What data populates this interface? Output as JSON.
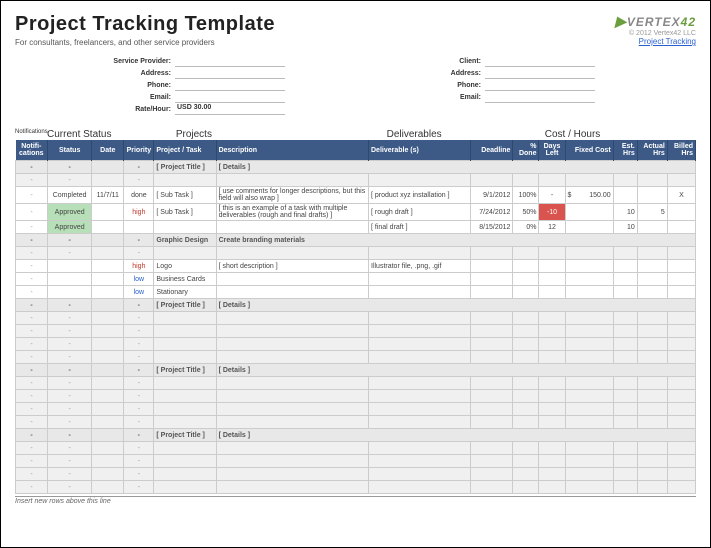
{
  "header": {
    "title": "Project Tracking Template",
    "subtitle": "For consultants, freelancers, and other service providers",
    "logo_text": "VERTEX",
    "logo_suffix": "42",
    "copyright": "© 2012 Vertex42 LLC",
    "link": "Project Tracking"
  },
  "provider": {
    "labels": {
      "name": "Service Provider:",
      "address": "Address:",
      "phone": "Phone:",
      "email": "Email:",
      "rate": "Rate/Hour:"
    },
    "rate": "USD 30.00"
  },
  "client": {
    "labels": {
      "name": "Client:",
      "address": "Address:",
      "phone": "Phone:",
      "email": "Email:"
    }
  },
  "groups": {
    "notif": "Notifications",
    "status": "Current Status",
    "projects": "Projects",
    "deliv": "Deliverables",
    "cost": "Cost / Hours"
  },
  "cols": {
    "notif": "Notifi-cations",
    "status": "Status",
    "date": "Date",
    "prio": "Priority",
    "proj": "Project / Task",
    "desc": "Description",
    "deliv": "Deliverable (s)",
    "dead": "Deadline",
    "pct": "% Done",
    "days": "Days Left",
    "fixed": "Fixed Cost",
    "est": "Est. Hrs",
    "act": "Actual Hrs",
    "bill": "Billed Hrs"
  },
  "rows": [
    {
      "type": "section",
      "proj": "[ Project Title ]",
      "desc": "[ Details ]"
    },
    {
      "type": "blank"
    },
    {
      "type": "data",
      "status": "Completed",
      "date": "11/7/11",
      "prio": "done",
      "proj": "[ Sub Task ]",
      "desc": "[ use comments for longer descriptions, but this field will also wrap ]",
      "deliv": "[ product xyz installation ]",
      "dead": "9/1/2012",
      "pct": "100%",
      "days": "-",
      "fixedp": "$",
      "fixed": "150.00",
      "bill": "X"
    },
    {
      "type": "data",
      "approved": true,
      "prio": "high",
      "prioClass": "red",
      "proj": "[ Sub Task ]",
      "desc": "[ this is an example of a task with multiple deliverables (rough and final drafts) ]",
      "deliv": "[ rough draft ]",
      "dead": "7/24/2012",
      "pct": "50%",
      "days": "-10",
      "daysNeg": true,
      "est": "10",
      "act": "5"
    },
    {
      "type": "data",
      "approved": true,
      "deliv": "[ final draft ]",
      "dead": "8/15/2012",
      "pct": "0%",
      "days": "12",
      "est": "10"
    },
    {
      "type": "section",
      "proj": "Graphic Design",
      "desc": "Create branding materials"
    },
    {
      "type": "blank"
    },
    {
      "type": "data",
      "prio": "high",
      "prioClass": "red",
      "proj": "Logo",
      "desc": "[ short description ]",
      "deliv": "Illustrator file, .png, .gif"
    },
    {
      "type": "data",
      "prio": "low",
      "prioClass": "blue",
      "proj": "Business Cards"
    },
    {
      "type": "data",
      "prio": "low",
      "prioClass": "blue",
      "proj": "Stationary"
    },
    {
      "type": "section",
      "proj": "[ Project Title ]",
      "desc": "[ Details ]"
    },
    {
      "type": "blank"
    },
    {
      "type": "blank"
    },
    {
      "type": "blank"
    },
    {
      "type": "blank"
    },
    {
      "type": "section",
      "proj": "[ Project Title ]",
      "desc": "[ Details ]"
    },
    {
      "type": "blank"
    },
    {
      "type": "blank"
    },
    {
      "type": "blank"
    },
    {
      "type": "blank"
    },
    {
      "type": "section",
      "proj": "[ Project Title ]",
      "desc": "[ Details ]"
    },
    {
      "type": "blank"
    },
    {
      "type": "blank"
    },
    {
      "type": "blank"
    },
    {
      "type": "blank"
    }
  ],
  "footer": "Insert new rows above this line",
  "approvedLabel": "Approved",
  "dash": "-"
}
